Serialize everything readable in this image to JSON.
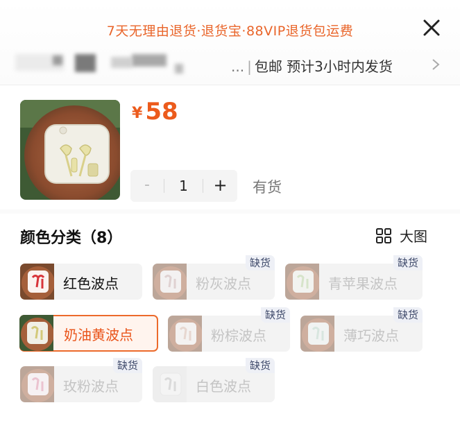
{
  "header": {
    "promo": "7天无理由退货·退货宝·88VIP退货包运费",
    "shipping_ellipsis": "...",
    "shipping_sep": "|",
    "shipping_text": "包邮 预计3小时内发货"
  },
  "product": {
    "currency": "¥",
    "price": "58",
    "quantity": "1",
    "stepper_minus": "-",
    "stepper_plus": "+",
    "stock": "有货"
  },
  "section": {
    "title": "颜色分类（8）",
    "big_view": "大图"
  },
  "options": [
    {
      "label": "红色波点",
      "tag": ""
    },
    {
      "label": "粉灰波点",
      "tag": "缺货"
    },
    {
      "label": "青苹果波点",
      "tag": "缺货"
    },
    {
      "label": "奶油黄波点",
      "tag": ""
    },
    {
      "label": "粉棕波点",
      "tag": "缺货"
    },
    {
      "label": "薄巧波点",
      "tag": "缺货"
    },
    {
      "label": "玫粉波点",
      "tag": "缺货"
    },
    {
      "label": "白色波点",
      "tag": "缺货"
    }
  ],
  "colors": {
    "accent": "#ec5b1c",
    "promo": "#e9652a",
    "soldout_tag_bg": "#eef0f6"
  }
}
